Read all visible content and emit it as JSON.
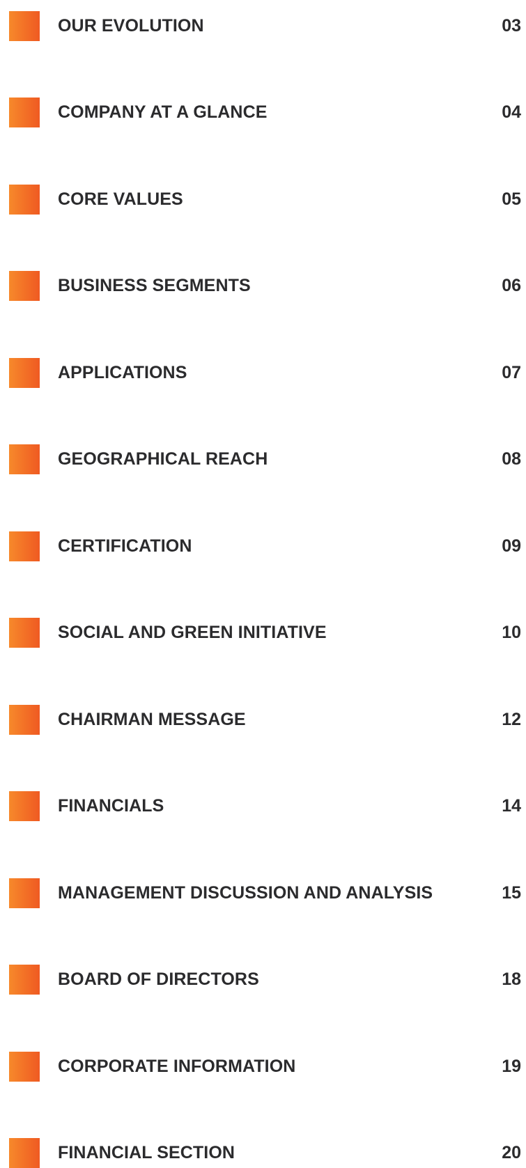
{
  "toc": {
    "items": [
      {
        "label": "OUR EVOLUTION",
        "page": "03"
      },
      {
        "label": "COMPANY AT A GLANCE",
        "page": "04"
      },
      {
        "label": "CORE VALUES",
        "page": "05"
      },
      {
        "label": "BUSINESS SEGMENTS",
        "page": "06"
      },
      {
        "label": "APPLICATIONS",
        "page": "07"
      },
      {
        "label": "GEOGRAPHICAL REACH",
        "page": "08"
      },
      {
        "label": "CERTIFICATION",
        "page": "09"
      },
      {
        "label": "SOCIAL AND GREEN INITIATIVE",
        "page": "10"
      },
      {
        "label": "CHAIRMAN MESSAGE",
        "page": "12"
      },
      {
        "label": "FINANCIALS",
        "page": "14"
      },
      {
        "label": "MANAGEMENT DISCUSSION AND ANALYSIS",
        "page": "15"
      },
      {
        "label": "BOARD OF DIRECTORS",
        "page": "18"
      },
      {
        "label": "CORPORATE INFORMATION",
        "page": "19"
      },
      {
        "label": "FINANCIAL SECTION",
        "page": "20"
      }
    ]
  },
  "colors": {
    "marker_start": "#f7892b",
    "marker_end": "#ef5a22",
    "text": "#2b2b2d"
  }
}
